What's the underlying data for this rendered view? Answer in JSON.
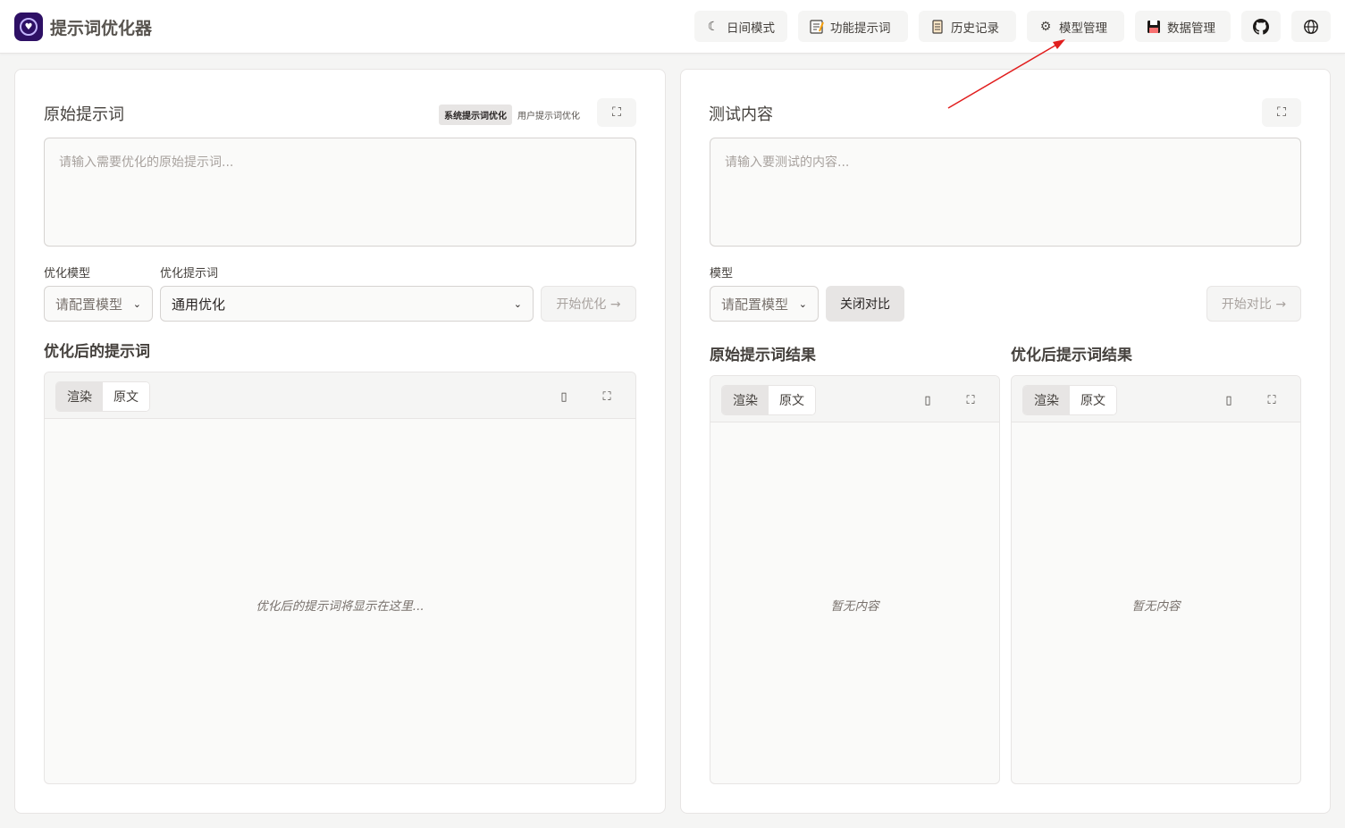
{
  "header": {
    "app_title": "提示词优化器",
    "nav": [
      {
        "label": "日间模式",
        "icon": "moon-icon"
      },
      {
        "label": "功能提示词",
        "icon": "memo-icon"
      },
      {
        "label": "历史记录",
        "icon": "scroll-icon"
      },
      {
        "label": "模型管理",
        "icon": "gear-icon"
      },
      {
        "label": "数据管理",
        "icon": "floppy-disk-icon"
      }
    ],
    "github_icon": "github-icon",
    "language_icon": "globe-icon"
  },
  "left": {
    "title": "原始提示词",
    "mode_tabs": [
      "系统提示词优化",
      "用户提示词优化"
    ],
    "input_placeholder": "请输入需要优化的原始提示词...",
    "model_label": "优化模型",
    "model_value": "请配置模型",
    "template_label": "优化提示词",
    "template_value": "通用优化",
    "start_label": "开始优化 →",
    "output_title": "优化后的提示词",
    "view_tabs": [
      "渲染",
      "原文"
    ],
    "output_empty": "优化后的提示词将显示在这里..."
  },
  "right": {
    "title": "测试内容",
    "input_placeholder": "请输入要测试的内容...",
    "model_label": "模型",
    "model_value": "请配置模型",
    "compare_toggle": "关闭对比",
    "start_compare": "开始对比 →",
    "original_result_title": "原始提示词结果",
    "optimized_result_title": "优化后提示词结果",
    "view_tabs": [
      "渲染",
      "原文"
    ],
    "empty_text": "暂无内容"
  },
  "colors": {
    "logo_bg": "#2e1065",
    "annotation_arrow": "#e11d1d"
  }
}
